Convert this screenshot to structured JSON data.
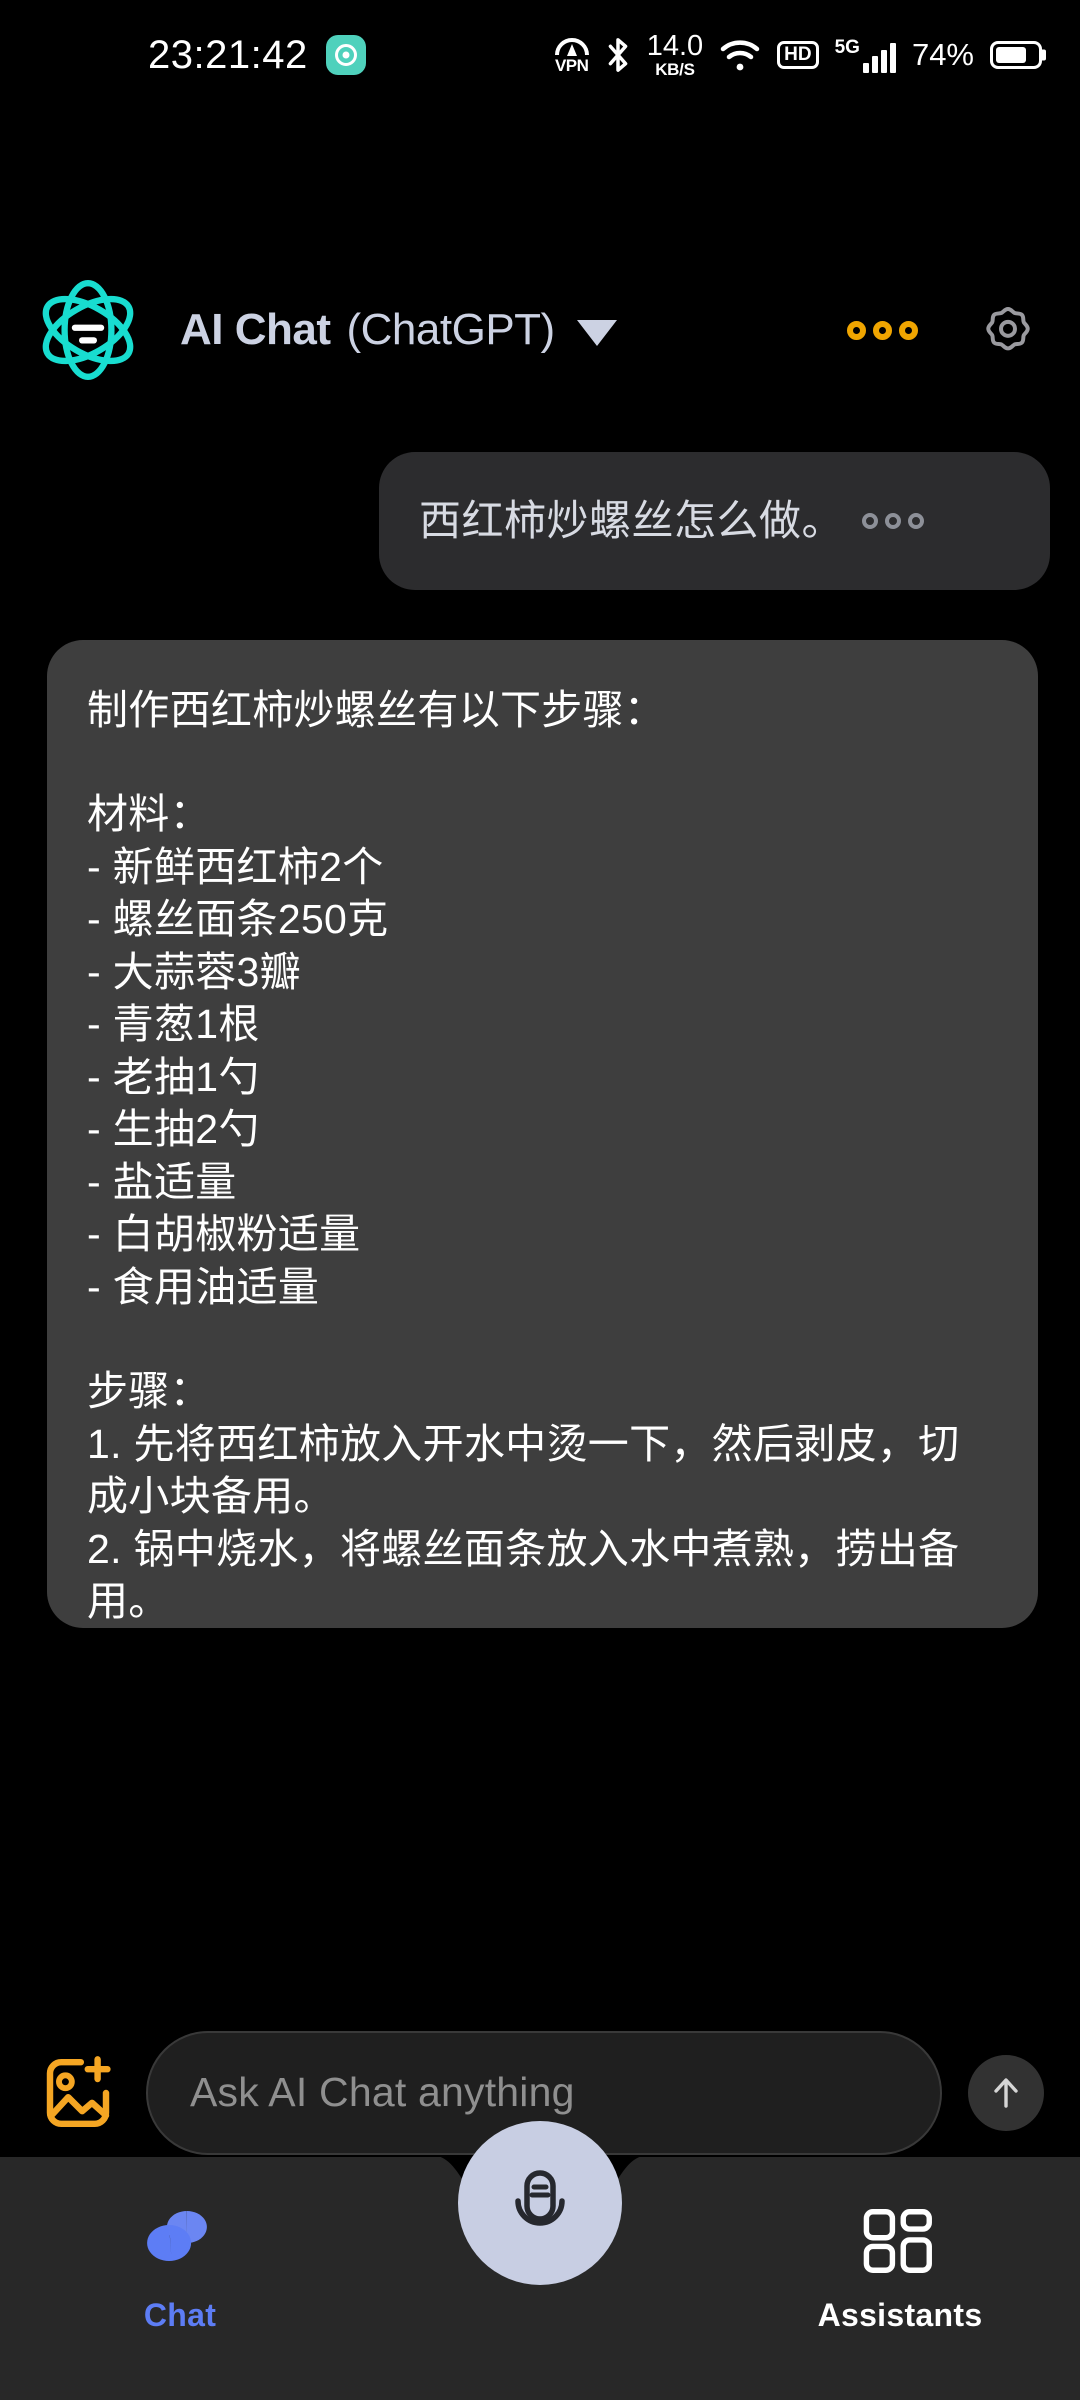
{
  "statusbar": {
    "time": "23:21:42",
    "app_icon": "music-app-icon",
    "vpn_label": "VPN",
    "bluetooth_icon": "bluetooth-icon",
    "net_speed_value": "14.0",
    "net_speed_unit": "KB/S",
    "wifi_icon": "wifi-icon",
    "hd_label": "HD",
    "network_label": "5G",
    "signal_icon": "signal-bars-icon",
    "battery_percent": "74%",
    "battery_icon": "battery-icon"
  },
  "header": {
    "logo_icon": "atom-logo-icon",
    "title_main": "AI Chat",
    "title_sub": "(ChatGPT)",
    "caret_icon": "chevron-down-icon",
    "more_icon": "more-dots-icon",
    "settings_icon": "gear-icon",
    "accent_orange": "#f0a500",
    "accent_cyan": "#1ee0d0",
    "title_color": "#ccd2e3"
  },
  "chat": {
    "user_message": {
      "text": "西红柿炒螺丝怎么做。",
      "more_icon": "more-dots-icon",
      "bubble_color": "#2c2c2e"
    },
    "ai_message": {
      "bubble_color": "#3e3e3e",
      "intro": "制作西红柿炒螺丝有以下步骤：",
      "materials_heading": "材料：",
      "materials": [
        "- 新鲜西红柿2个",
        "- 螺丝面条250克",
        "- 大蒜蓉3瓣",
        "- 青葱1根",
        "- 老抽1勺",
        "- 生抽2勺",
        "- 盐适量",
        "- 白胡椒粉适量",
        "- 食用油适量"
      ],
      "steps_heading": "步骤：",
      "steps": [
        "1. 先将西红柿放入开水中烫一下，然后剥皮，切成小块备用。",
        "2. 锅中烧水，将螺丝面条放入水中煮熟，捞出备用。"
      ]
    }
  },
  "input": {
    "image_icon": "add-image-icon",
    "placeholder": "Ask AI Chat anything",
    "value": "",
    "send_icon": "arrow-up-icon"
  },
  "bottomnav": {
    "items": [
      {
        "label": "Chat",
        "icon": "chat-bubbles-icon",
        "active": true
      },
      {
        "label": "Assistants",
        "icon": "grid-squares-icon",
        "active": false
      }
    ],
    "mic_button_icon": "microphone-icon",
    "active_color": "#5d7df5",
    "fab_color": "#c8cee3"
  }
}
